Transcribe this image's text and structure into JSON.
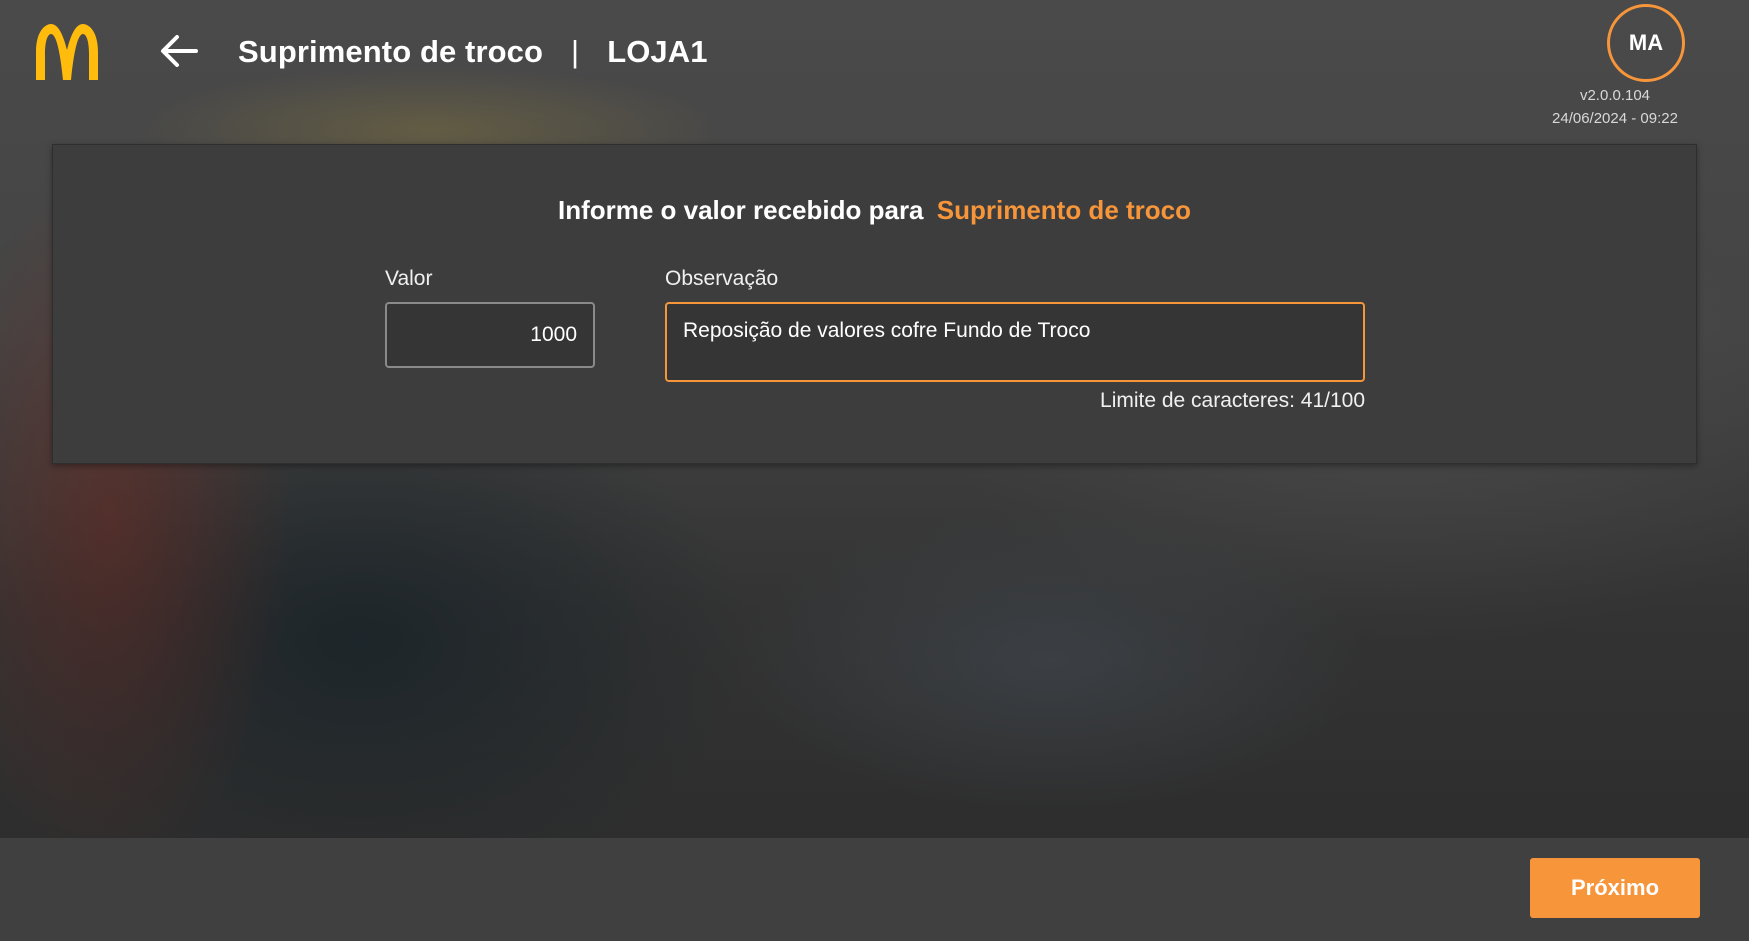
{
  "header": {
    "title": "Suprimento de troco",
    "separator": "|",
    "store": "LOJA1",
    "avatar_initials": "MA",
    "version": "v2.0.0.104",
    "datetime": "24/06/2024 - 09:22",
    "logo_icon": "mcdonalds-arches-logo",
    "back_icon": "arrow-left-icon"
  },
  "form": {
    "prompt_text": "Informe o valor recebido para",
    "prompt_highlight": "Suprimento de troco",
    "valor_label": "Valor",
    "valor_value": "1000",
    "observacao_label": "Observação",
    "observacao_value": "Reposição de valores cofre Fundo de Troco",
    "limit_text": "Limite de caracteres: 41/100"
  },
  "footer": {
    "next_label": "Próximo"
  },
  "colors": {
    "accent": "#f6953a",
    "logo_yellow": "#ffbc0d",
    "card_bg": "#3d3d3d",
    "footer_bg": "#404040"
  }
}
